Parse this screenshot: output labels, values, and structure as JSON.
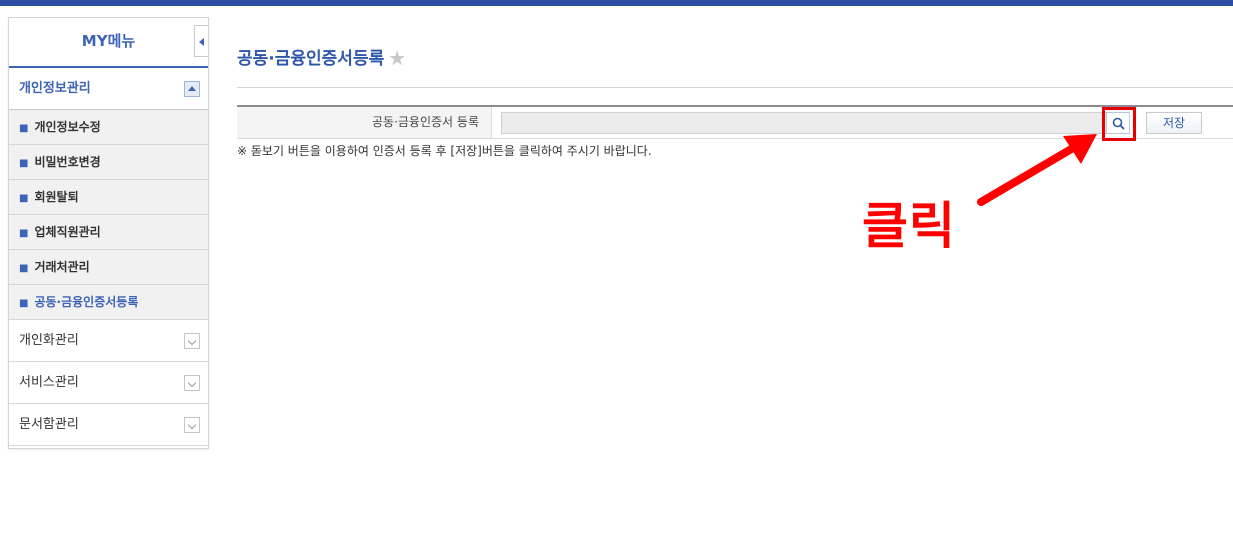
{
  "sidebar": {
    "title": "MY메뉴",
    "groups": [
      {
        "label": "개인정보관리",
        "expanded": true,
        "items": [
          {
            "label": "개인정보수정"
          },
          {
            "label": "비밀번호변경"
          },
          {
            "label": "회원탈퇴"
          },
          {
            "label": "업체직원관리"
          },
          {
            "label": "거래처관리"
          },
          {
            "label": "공동·금융인증서등록",
            "current": true
          }
        ]
      },
      {
        "label": "개인화관리",
        "expanded": false
      },
      {
        "label": "서비스관리",
        "expanded": false
      },
      {
        "label": "문서함관리",
        "expanded": false
      }
    ]
  },
  "main": {
    "title": "공동·금융인증서등록",
    "form": {
      "label": "공동·금융인증서 등록",
      "input_value": "",
      "save_label": "저장"
    },
    "notice": "※ 돋보기 버튼을 이용하여 인증서 등록 후 [저장]버튼을 클릭하여 주시기 바랍니다."
  },
  "annotation": {
    "text": "클릭",
    "color": "#ff0000"
  },
  "colors": {
    "brand": "#2d4ea3",
    "accent": "#3c63b6",
    "highlight": "#e60000"
  }
}
